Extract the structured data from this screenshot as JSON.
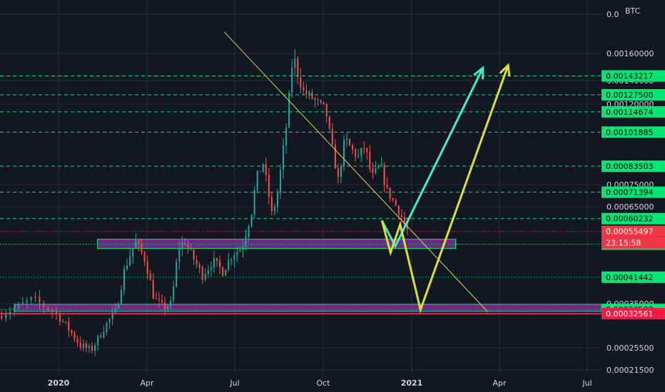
{
  "currency": "BTC",
  "colors": {
    "background": "#131722",
    "grid": "#2a2e39",
    "candle_up": "#26a69a",
    "candle_down": "#ef5350",
    "level_green": "#00e676",
    "zone": "#9c27b0",
    "trendline": "#e0d060",
    "arrow_cyan": "#3ef0c0",
    "arrow_yellow": "#d8e040",
    "support_red": "#ff1744",
    "current_price": "#f23645"
  },
  "chart_data": {
    "type": "candlestick",
    "title": "",
    "ylabel": "BTC",
    "x_ticks": [
      "2020",
      "Apr",
      "Jul",
      "Oct",
      "2021",
      "Apr",
      "Jul"
    ],
    "y_ticks": [
      "0.0",
      "0.00160000",
      "0.00140000",
      "0.00120000",
      "0.00075000",
      "0.00065000",
      "0.00035000",
      "0.00025500",
      "0.00021500"
    ],
    "ylim": [
      0.00021,
      0.0019
    ],
    "levels": [
      {
        "value": 0.00143217,
        "label": "0.00143217",
        "style": "dashed",
        "color": "#00e676"
      },
      {
        "value": 0.001275,
        "label": "0.00127500",
        "style": "dashed",
        "color": "#00e676"
      },
      {
        "value": 0.00114674,
        "label": "0.00114674",
        "style": "dashed",
        "color": "#00e676"
      },
      {
        "value": 0.00101885,
        "label": "0.00101885",
        "style": "dashed",
        "color": "#00e676"
      },
      {
        "value": 0.00083503,
        "label": "0.00083503",
        "style": "dashed",
        "color": "#00e676"
      },
      {
        "value": 0.00071394,
        "label": "0.00071394",
        "style": "dashed",
        "color": "#00e676"
      },
      {
        "value": 0.00060232,
        "label": "0.00060232",
        "style": "dashed",
        "color": "#00e676"
      },
      {
        "value": 0.0005118,
        "label": "0.00051180",
        "style": "dotted",
        "color": "#00e676"
      },
      {
        "value": 0.00041442,
        "label": "0.00041442",
        "style": "dotted",
        "color": "#00e676"
      },
      {
        "value": 0.0003358,
        "label": "0.00033580",
        "style": "dotted",
        "color": "#00e676"
      }
    ],
    "current_price": {
      "value": 0.00055497,
      "label": "0.00055497",
      "countdown": "23:15:58"
    },
    "support_line": {
      "value": 0.00032561,
      "label": "0.00032561"
    },
    "zones": [
      {
        "from_date": "2020-02-10",
        "to_date": "2021-02-15",
        "top": 0.000528,
        "bottom": 0.000498
      },
      {
        "from_date": "2019-12-01",
        "to_date": "2021-07-31",
        "top": 0.000348,
        "bottom": 0.000331
      }
    ],
    "trendline": {
      "start": [
        "2020-06-20",
        0.00178
      ],
      "end": [
        "2021-03-20",
        0.00033
      ]
    },
    "projection_cyan": [
      [
        "2020-12-01",
        0.000595
      ],
      [
        "2020-12-15",
        0.000505
      ],
      [
        "2021-03-15",
        0.00149
      ]
    ],
    "projection_yellow": [
      [
        "2020-12-01",
        0.000595
      ],
      [
        "2020-12-10",
        0.000485
      ],
      [
        "2020-12-20",
        0.00058
      ],
      [
        "2021-01-10",
        0.000335
      ],
      [
        "2021-04-10",
        0.00151
      ]
    ],
    "price_path": [
      [
        "2019-11-20",
        0.00032
      ],
      [
        "2019-12-15",
        0.00036
      ],
      [
        "2019-12-30",
        0.00033
      ],
      [
        "2020-01-10",
        0.0003
      ],
      [
        "2020-01-25",
        0.00026
      ],
      [
        "2020-02-05",
        0.00025
      ],
      [
        "2020-02-20",
        0.0003
      ],
      [
        "2020-03-01",
        0.00033
      ],
      [
        "2020-03-10",
        0.00043
      ],
      [
        "2020-03-15",
        0.00047
      ],
      [
        "2020-03-22",
        0.00052
      ],
      [
        "2020-04-01",
        0.00046
      ],
      [
        "2020-04-10",
        0.00036
      ],
      [
        "2020-04-20",
        0.00034
      ],
      [
        "2020-04-28",
        0.00035
      ],
      [
        "2020-05-05",
        0.0005
      ],
      [
        "2020-05-12",
        0.00052
      ],
      [
        "2020-05-20",
        0.00047
      ],
      [
        "2020-05-30",
        0.00042
      ],
      [
        "2020-06-10",
        0.00046
      ],
      [
        "2020-06-20",
        0.00043
      ],
      [
        "2020-06-30",
        0.00048
      ],
      [
        "2020-07-10",
        0.0005
      ],
      [
        "2020-07-20",
        0.00063
      ],
      [
        "2020-07-25",
        0.00078
      ],
      [
        "2020-08-01",
        0.00085
      ],
      [
        "2020-08-05",
        0.00075
      ],
      [
        "2020-08-10",
        0.00062
      ],
      [
        "2020-08-15",
        0.00068
      ],
      [
        "2020-08-25",
        0.00105
      ],
      [
        "2020-09-01",
        0.0016
      ],
      [
        "2020-09-06",
        0.00145
      ],
      [
        "2020-09-12",
        0.0013
      ],
      [
        "2020-09-18",
        0.00127
      ],
      [
        "2020-09-25",
        0.00122
      ],
      [
        "2020-10-05",
        0.00116
      ],
      [
        "2020-10-10",
        0.00098
      ],
      [
        "2020-10-18",
        0.00077
      ],
      [
        "2020-10-25",
        0.00098
      ],
      [
        "2020-11-01",
        0.00092
      ],
      [
        "2020-11-08",
        0.00088
      ],
      [
        "2020-11-15",
        0.00094
      ],
      [
        "2020-11-22",
        0.00078
      ],
      [
        "2020-12-01",
        0.00084
      ],
      [
        "2020-12-08",
        0.00072
      ],
      [
        "2020-12-15",
        0.00067
      ],
      [
        "2020-12-22",
        0.00062
      ],
      [
        "2020-12-28",
        0.00056
      ]
    ]
  }
}
